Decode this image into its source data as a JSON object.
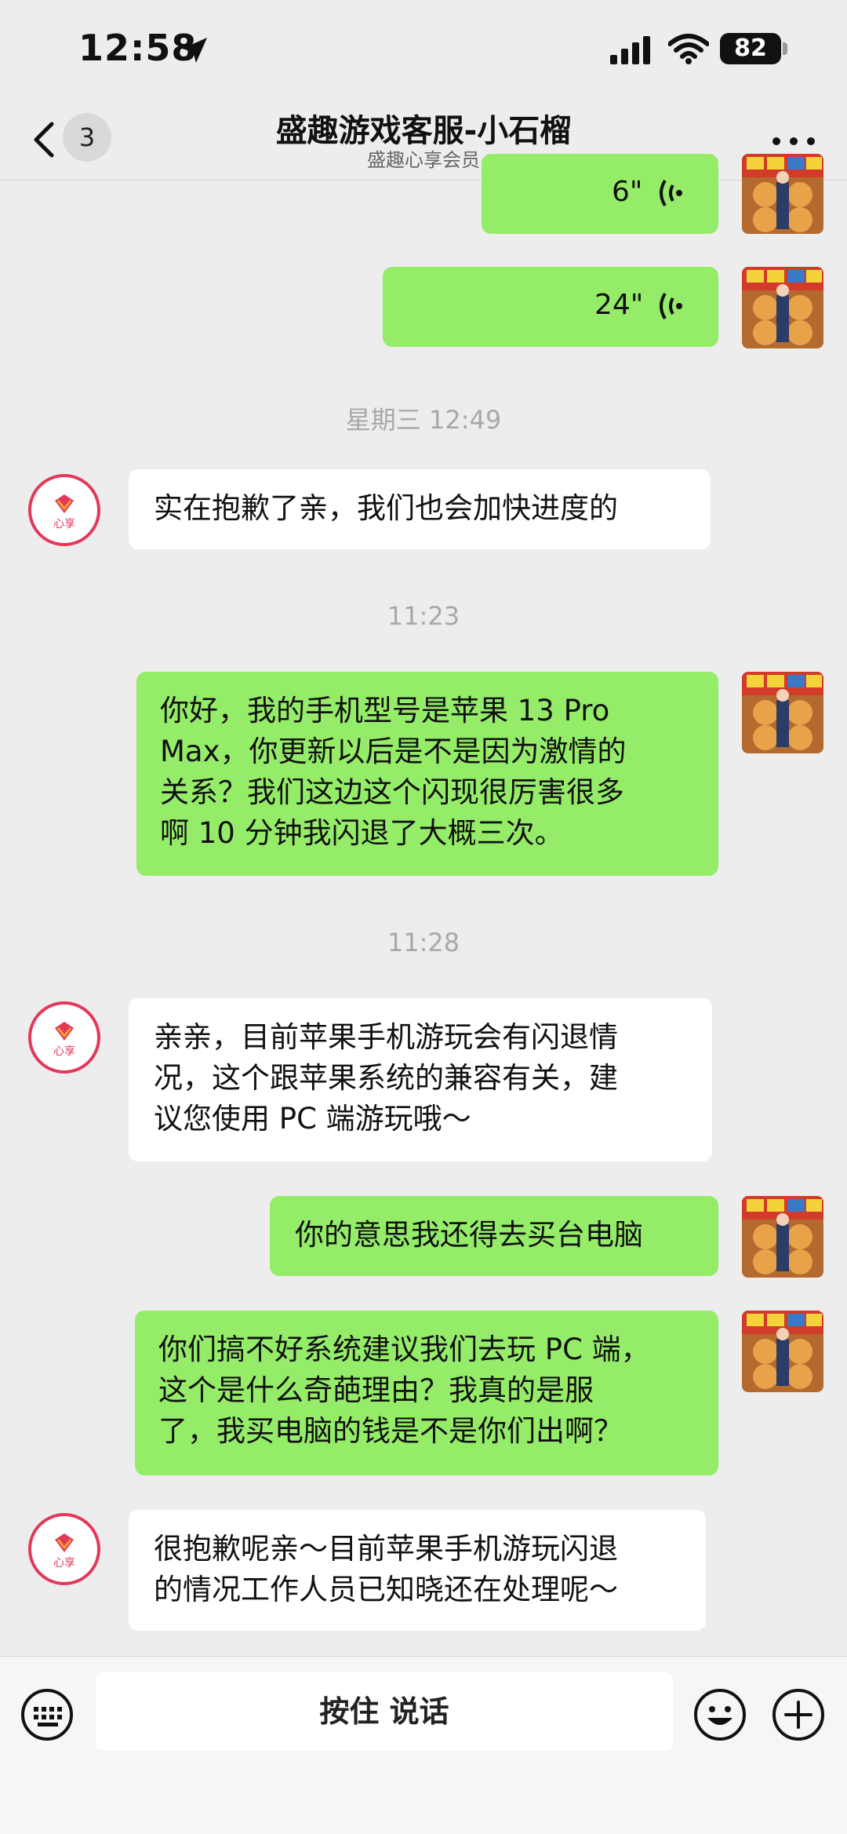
{
  "status": {
    "time": "12:58",
    "battery": "82"
  },
  "nav": {
    "back_count": "3",
    "title": "盛趣游戏客服-小石榴",
    "subtitle": "盛趣心享会员"
  },
  "messages": {
    "voice1": "6\"",
    "voice2": "24\"",
    "ts1": "星期三 12:49",
    "svc1": "实在抱歉了亲，我们也会加快进度的",
    "ts2": "11:23",
    "me1": [
      "你好，我的手机型号是苹果 13 Pro",
      "Max，你更新以后是不是因为激情的",
      "关系？我们这边这个闪现很厉害很多",
      "啊 10 分钟我闪退了大概三次。"
    ],
    "ts3": "11:28",
    "svc2": [
      "亲亲，目前苹果手机游玩会有闪退情",
      "况，这个跟苹果系统的兼容有关，建",
      "议您使用 PC 端游玩哦～"
    ],
    "me2": "你的意思我还得去买台电脑",
    "me3": [
      "你们搞不好系统建议我们去玩 PC 端，",
      "这个是什么奇葩理由？我真的是服",
      "了，我买电脑的钱是不是你们出啊？"
    ],
    "svc3": [
      "很抱歉呢亲～目前苹果手机游玩闪退",
      "的情况工作人员已知晓还在处理呢～"
    ]
  },
  "avatar_label": "心享",
  "input": {
    "hold_to_talk": "按住 说话"
  },
  "colors": {
    "my_bubble": "#95ec69",
    "service_bubble": "#ffffff",
    "background": "#ededed",
    "avatar_ring": "#e3385a"
  }
}
